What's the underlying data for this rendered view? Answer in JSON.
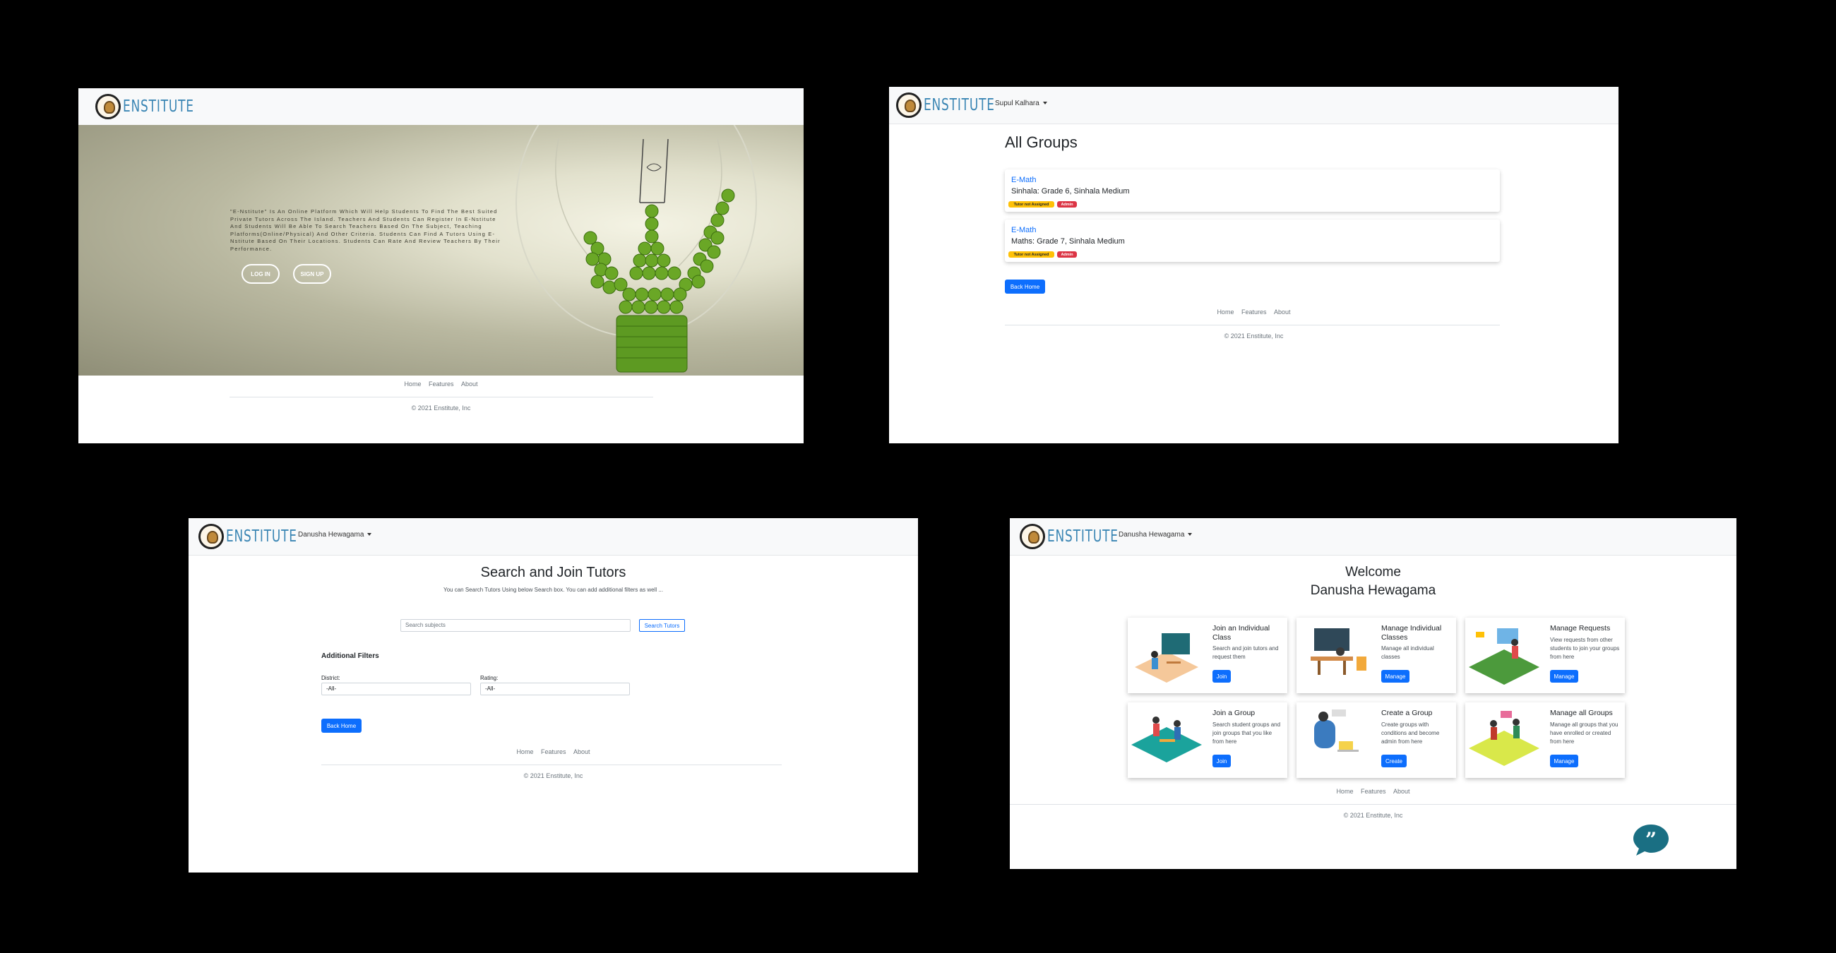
{
  "brand": "ENSTITUTE",
  "landing": {
    "description": "\"E-Nstitute\" Is An Online Platform Which Will Help Students To Find The Best Suited Private Tutors Across The Island. Teachers And Students Can Register In E-Nstitute And Students Will Be Able To Search Teachers Based On The Subject, Teaching Platforms(Online/Physical) And Other Criteria. Students Can Find A Tutors Using E-Nstitute Based On Their Locations. Students Can Rate And Review Teachers By Their Performance.",
    "login": "LOG IN",
    "signup": "SIGN UP"
  },
  "footer": {
    "home": "Home",
    "features": "Features",
    "about": "About",
    "copyright": "© 2021 Enstitute, Inc"
  },
  "groups_page": {
    "user": "Supul Kalhara",
    "title": "All Groups",
    "groups": [
      {
        "name": "E-Math",
        "detail": "Sinhala: Grade 6, Sinhala Medium",
        "status": "Tutor not Assigned",
        "role": "Admin"
      },
      {
        "name": "E-Math",
        "detail": "Maths: Grade 7, Sinhala Medium",
        "status": "Tutor not Assigned",
        "role": "Admin"
      }
    ],
    "back": "Back Home"
  },
  "search_page": {
    "user": "Danusha Hewagama",
    "title": "Search and Join Tutors",
    "subtitle": "You can Search Tutors Using below Search box. You can add additional filters as well ...",
    "search_placeholder": "Search subjects",
    "search_button": "Search Tutors",
    "filters_title": "Additional Filters",
    "district_label": "District:",
    "district_value": "-All-",
    "rating_label": "Rating:",
    "rating_value": "-All-",
    "back": "Back Home"
  },
  "dashboard": {
    "user": "Danusha Hewagama",
    "welcome": "Welcome",
    "name": "Danusha Hewagama",
    "cards": [
      {
        "title": "Join an Individual Class",
        "desc": "Search and join tutors and request them",
        "button": "Join"
      },
      {
        "title": "Manage Individual Classes",
        "desc": "Manage all individual classes",
        "button": "Manage"
      },
      {
        "title": "Manage Requests",
        "desc": "View requests from other students to join your groups from here",
        "button": "Manage"
      },
      {
        "title": "Join a Group",
        "desc": "Search student groups and join groups that you like from here",
        "button": "Join"
      },
      {
        "title": "Create a Group",
        "desc": "Create groups with conditions and become admin from here",
        "button": "Create"
      },
      {
        "title": "Manage all Groups",
        "desc": "Manage all groups that you have enrolled or created from here",
        "button": "Manage"
      }
    ]
  },
  "colors": {
    "primary": "#0d6efd",
    "brand": "#3b86b4",
    "warning": "#ffc107",
    "danger": "#dc3545",
    "chat": "#1a6f83"
  }
}
